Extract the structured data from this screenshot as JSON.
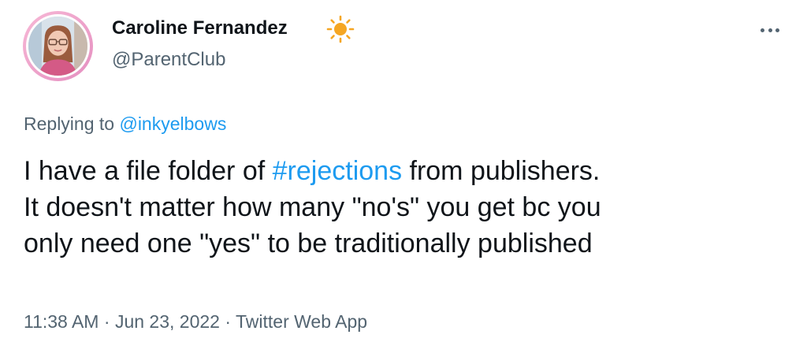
{
  "author": {
    "display_name": "Caroline Fernandez",
    "emoji": "sun-icon",
    "handle": "@ParentClub"
  },
  "reply_context": {
    "prefix": "Replying to",
    "target": "@inkyelbows"
  },
  "tweet": {
    "line1_before": "I have a file folder of ",
    "hashtag": "#rejections",
    "line1_after": " from publishers.",
    "line2": "It doesn't matter how many \"no's\" you get bc you",
    "line3": "only need one \"yes\" to be traditionally published"
  },
  "meta": {
    "time": "11:38 AM",
    "separator": "·",
    "date": "Jun 23, 2022",
    "source": "Twitter Web App"
  },
  "colors": {
    "link": "#1d9bf0",
    "secondary_text": "#536471",
    "primary_text": "#0f1419",
    "avatar_ring": "#f7b8d6",
    "sun": "#f5a623"
  },
  "icons": [
    "more-icon",
    "sun-icon",
    "avatar"
  ]
}
